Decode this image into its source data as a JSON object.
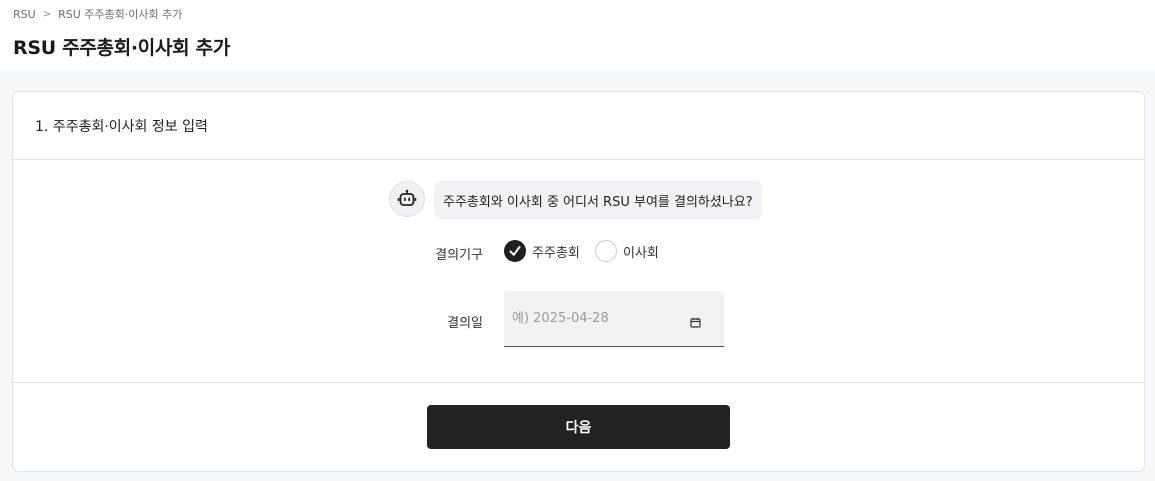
{
  "breadcrumb": {
    "items": [
      "RSU",
      "RSU 주주총회·이사회 추가"
    ],
    "separator": ">"
  },
  "page": {
    "title": "RSU 주주총회·이사회 추가"
  },
  "section": {
    "title": "1. 주주총회·이사회 정보 입력",
    "question": "주주총회와 이사회 중 어디서 RSU 부여를 결의하셨나요?",
    "assistant_icon": "robot-icon"
  },
  "form": {
    "body_label": "결의기구",
    "options": [
      {
        "label": "주주총회",
        "checked": true
      },
      {
        "label": "이사회",
        "checked": false
      }
    ],
    "date_label": "결의일",
    "date_placeholder": "예) 2025-04-28",
    "date_value": "",
    "date_icon": "calendar-icon"
  },
  "footer": {
    "next_label": "다음"
  },
  "colors": {
    "primary": "#222222",
    "border": "#e3e4e8",
    "background": "#f7f8fa"
  }
}
